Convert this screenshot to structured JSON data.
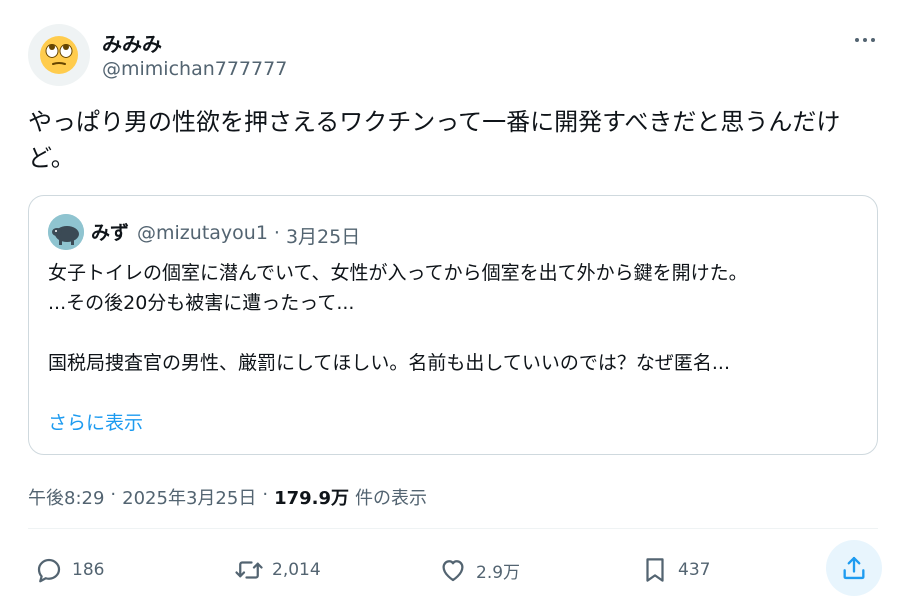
{
  "author": {
    "display_name": "みみみ",
    "handle": "@mimichan777777",
    "avatar_icon": "face-with-rolling-eyes-emoji"
  },
  "tweet": {
    "text": "やっぱり男の性欲を押さえるワクチンって一番に開発すべきだと思うんだけど。"
  },
  "quoted_tweet": {
    "display_name": "みず",
    "handle": "@mizutayou1",
    "separator": "·",
    "date": "3月25日",
    "lines": [
      "女子トイレの個室に潜んでいて、女性が入ってから個室を出て外から鍵を開けた。",
      "...その後20分も被害に遭ったって...",
      "",
      "国税局捜査官の男性、厳罰にしてほしい。名前も出していいのでは？なぜ匿名..."
    ],
    "show_more": "さらに表示"
  },
  "meta": {
    "time": "午後8:29",
    "separator": "·",
    "date": "2025年3月25日",
    "separator2": "·",
    "views": "179.9万",
    "views_label": "件の表示"
  },
  "actions": {
    "replies": "186",
    "retweets": "2,014",
    "likes": "2.9万",
    "bookmarks": "437"
  },
  "colors": {
    "text_primary": "#0f1419",
    "text_secondary": "#536471",
    "link": "#1d9bf0",
    "border": "#cfd9de"
  }
}
